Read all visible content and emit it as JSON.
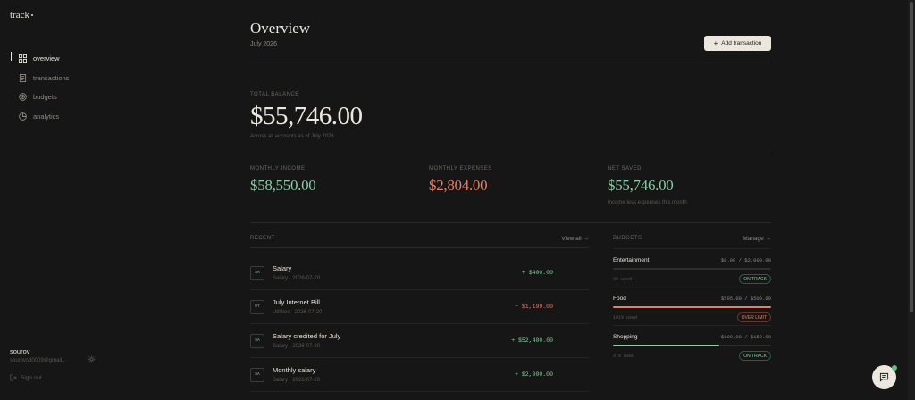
{
  "app": {
    "logo": "track"
  },
  "sidebar": {
    "items": [
      {
        "label": "overview",
        "icon": "grid-icon",
        "active": true
      },
      {
        "label": "transactions",
        "icon": "receipt-icon",
        "active": false
      },
      {
        "label": "budgets",
        "icon": "target-icon",
        "active": false
      },
      {
        "label": "analytics",
        "icon": "pie-icon",
        "active": false
      }
    ],
    "user": {
      "name": "sourov",
      "email": "sourovsd0009@gmail..."
    },
    "signout_label": "Sign out"
  },
  "header": {
    "title": "Overview",
    "subtitle": "July 2026",
    "add_label": "Add transaction"
  },
  "balance": {
    "label": "TOTAL BALANCE",
    "value": "$55,746.00",
    "sub": "Across all accounts as of July 2026"
  },
  "stats": [
    {
      "label": "MONTHLY INCOME",
      "value": "$58,550.00",
      "sub": "",
      "tone": "green"
    },
    {
      "label": "MONTHLY EXPENSES",
      "value": "$2,804.00",
      "sub": "",
      "tone": "red"
    },
    {
      "label": "NET SAVED",
      "value": "$55,746.00",
      "sub": "Income less expenses this month",
      "tone": "green"
    }
  ],
  "recent": {
    "label": "RECENT",
    "view_all": "View all →",
    "items": [
      {
        "badge": "SA",
        "name": "Salary",
        "meta": "Salary · 2026-07-20",
        "amount": "+ $400.00",
        "type": "in"
      },
      {
        "badge": "UT",
        "name": "July Internet Bill",
        "meta": "Utilities · 2026-07-20",
        "amount": "− $1,199.00",
        "type": "out"
      },
      {
        "badge": "SA",
        "name": "Salary credited for July",
        "meta": "Salary · 2026-07-20",
        "amount": "+ $52,400.00",
        "type": "in"
      },
      {
        "badge": "SA",
        "name": "Monthly salary",
        "meta": "Salary · 2026-07-20",
        "amount": "+ $2,000.00",
        "type": "in"
      }
    ]
  },
  "budgets": {
    "label": "BUDGETS",
    "manage": "Manage →",
    "items": [
      {
        "name": "Entertainment",
        "spent": "$0.00",
        "limit": "$2,000.00",
        "used": "0% used",
        "fraction": 0.0,
        "status": "ON TRACK",
        "state": "ok",
        "color": "#8dcba4"
      },
      {
        "name": "Food",
        "spent": "$505.00",
        "limit": "$500.00",
        "used": "101% used",
        "fraction": 1.0,
        "status": "OVER LIMIT",
        "state": "over",
        "color": "#e0806a"
      },
      {
        "name": "Shopping",
        "spent": "$100.00",
        "limit": "$150.00",
        "used": "67% used",
        "fraction": 0.67,
        "status": "ON TRACK",
        "state": "ok",
        "color": "#8dcba4"
      }
    ]
  }
}
